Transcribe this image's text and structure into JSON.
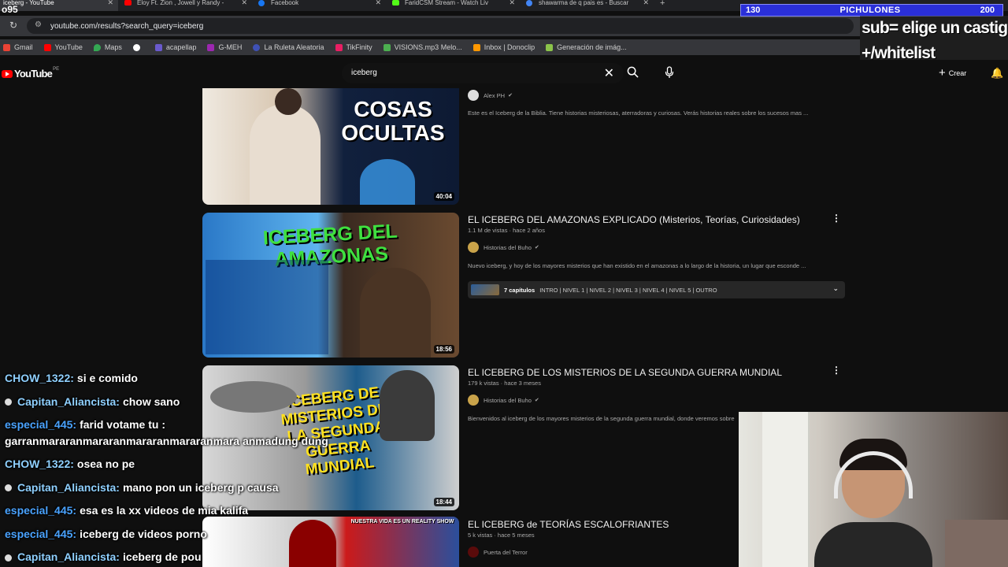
{
  "stream_counter": "o95",
  "tabs": [
    {
      "title": "iceberg - YouTube",
      "color": "#ff0000"
    },
    {
      "title": "Eloy Ft. Zion , Jowell y Randy - ",
      "color": "#ff0000"
    },
    {
      "title": "Facebook",
      "color": "#1877f2"
    },
    {
      "title": "FaridCSM Stream - Watch Liv",
      "color": "#53fc18"
    },
    {
      "title": "shawarma de q pais es - Buscar",
      "color": "#4285f4"
    }
  ],
  "new_tab_symbol": "+",
  "address": {
    "url": "youtube.com/results?search_query=iceberg"
  },
  "bookmarks": [
    {
      "label": "Gmail",
      "color": "#ea4335"
    },
    {
      "label": "YouTube",
      "color": "#ff0000"
    },
    {
      "label": "Maps",
      "color": "#34a853"
    },
    {
      "label": "",
      "color": "#ffffff"
    },
    {
      "label": "acapellap",
      "color": "#6a5acd"
    },
    {
      "label": "G-MEH",
      "color": "#9c27b0"
    },
    {
      "label": "La Ruleta Aleatoria",
      "color": "#3f51b5"
    },
    {
      "label": "TikFinity",
      "color": "#e91e63"
    },
    {
      "label": "VISIONS.mp3 Melo...",
      "color": "#4caf50"
    },
    {
      "label": "Inbox | Donoclip",
      "color": "#ff9800"
    },
    {
      "label": "Generación de imág...",
      "color": "#8bc34a"
    }
  ],
  "overlay": {
    "left": "130",
    "middle": "PICHULONES",
    "right": "200",
    "line1": "sub= elige un castigo",
    "line2": "+/whitelist"
  },
  "yt": {
    "logo_word": "YouTube",
    "country": "PE",
    "search_value": "iceberg",
    "crear": "Crear"
  },
  "results": [
    {
      "title": "",
      "meta": "",
      "channel": "Alex PH",
      "desc": "Este es el Iceberg de la Biblia. Tiene historias misteriosas, aterradoras y curiosas. Verás historias reales sobre los sucesos mas ...",
      "duration": "40:04",
      "thumb_text": "COSAS OCULTAS"
    },
    {
      "title": "EL ICEBERG DEL AMAZONAS EXPLICADO (Misterios, Teorías, Curiosidades)",
      "meta": "1.1 M de vistas · hace 2 años",
      "channel": "Historias del Buho",
      "desc": "Nuevo iceberg, y hoy de los mayores misterios que han existido en el amazonas a lo largo de la historia, un lugar que esconde ...",
      "duration": "18:56",
      "thumb_text": "ICEBERG DEL AMAZONAS",
      "chapters_count": "7 capítulos",
      "chapters_list": "INTRO | NIVEL 1 | NIVEL 2 | NIVEL 3 | NIVEL 4 | NIVEL 5 | OUTRO"
    },
    {
      "title": "EL ICEBERG DE LOS MISTERIOS DE LA SEGUNDA GUERRA MUNDIAL",
      "meta": "179 k vistas · hace 3 meses",
      "channel": "Historias del Buho",
      "desc": "Bienvenidos al iceberg de los mayores misterios de la segunda guerra mundial, donde veremos sobre",
      "duration": "18:44",
      "thumb_text": "ICEBERG DE MISTERIOS DE LA SEGUNDA GUERRA MUNDIAL"
    },
    {
      "title": "EL ICEBERG de TEORÍAS ESCALOFRIANTES",
      "meta": "5 k vistas · hace 5 meses",
      "channel": "Puerta del Terror",
      "desc": "",
      "duration": "",
      "thumb_text": "NUESTRA VIDA ES UN REALITY SHOW"
    }
  ],
  "chat": [
    {
      "user": "CHOW_1322:",
      "text": "si e comido",
      "color": "#8fd0ff",
      "dot": false
    },
    {
      "user": "Capitan_Aliancista:",
      "text": "chow sano",
      "color": "#8fd0ff",
      "dot": true
    },
    {
      "user": "especial_445:",
      "text": "farid votame tu :",
      "cont": "garranmararanmararanmararanmararanmara anmadung dung",
      "color": "#4aa3ff",
      "dot": false
    },
    {
      "user": "CHOW_1322:",
      "text": "osea no pe",
      "color": "#8fd0ff",
      "dot": false
    },
    {
      "user": "Capitan_Aliancista:",
      "text": "mano pon un iceberg p causa",
      "color": "#8fd0ff",
      "dot": true
    },
    {
      "user": "especial_445:",
      "text": "esa es la xx videos de mia kalifa",
      "color": "#4aa3ff",
      "dot": false
    },
    {
      "user": "especial_445:",
      "text": "iceberg de videos porno",
      "color": "#4aa3ff",
      "dot": false
    },
    {
      "user": "Capitan_Aliancista:",
      "text": "iceberg de pou",
      "color": "#8fd0ff",
      "dot": true
    }
  ]
}
